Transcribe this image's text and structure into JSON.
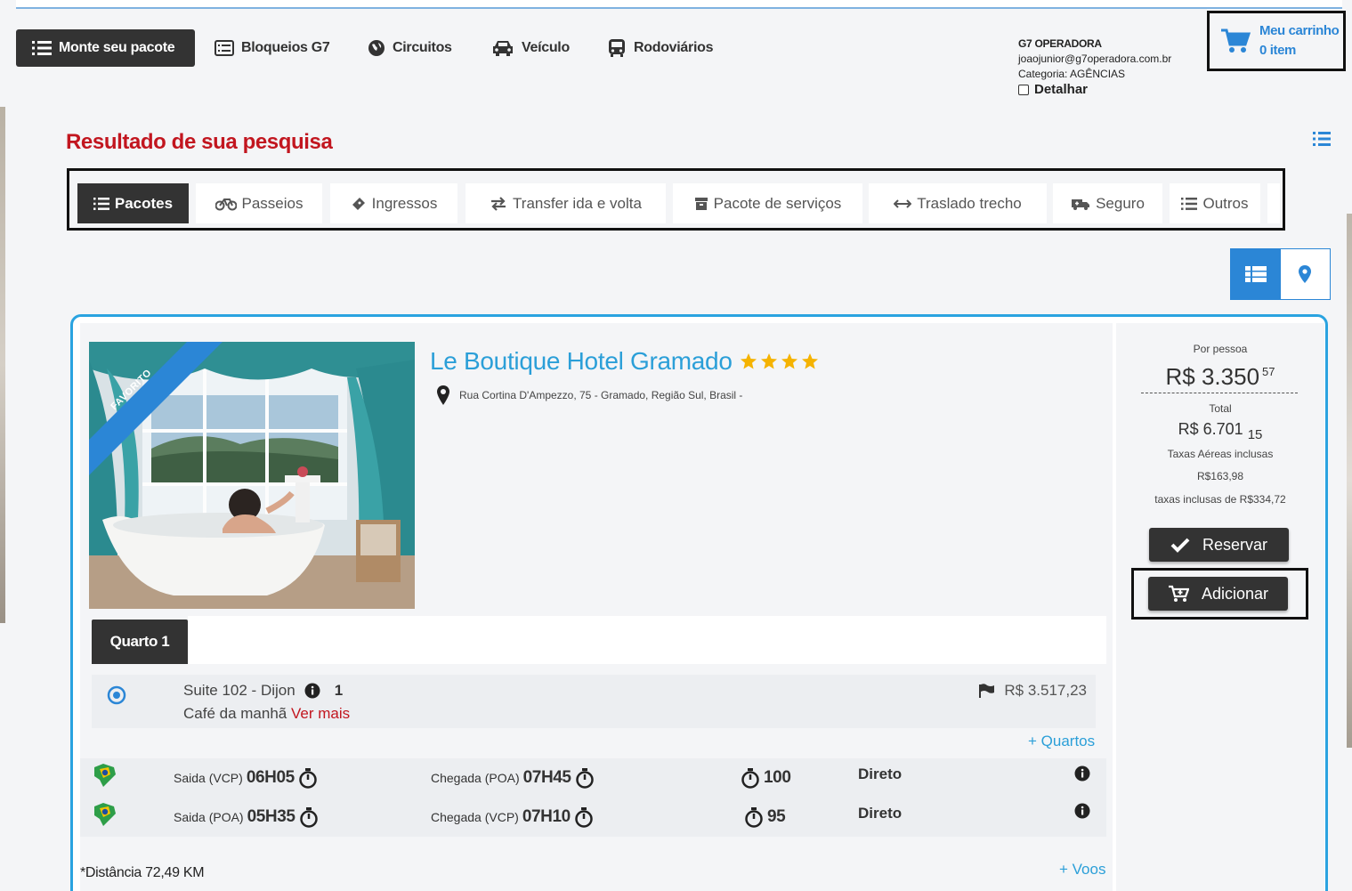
{
  "header": {
    "nav": [
      {
        "label": "Monte seu pacote",
        "icon": "list-icon"
      },
      {
        "label": "Bloqueios G7",
        "icon": "list-alt-icon"
      },
      {
        "label": "Circuitos",
        "icon": "globe-icon"
      },
      {
        "label": "Veículo",
        "icon": "car-icon"
      },
      {
        "label": "Rodoviários",
        "icon": "bus-icon"
      }
    ],
    "account": {
      "company": "G7 OPERADORA",
      "email": "joaojunior@g7operadora.com.br",
      "category": "Categoria: AGÊNCIAS",
      "detail_label": "Detalhar"
    },
    "cart": {
      "title": "Meu carrinho",
      "count": "0 item"
    }
  },
  "results": {
    "title": "Resultado de sua pesquisa",
    "tabs": [
      {
        "label": "Pacotes",
        "icon": "list-icon"
      },
      {
        "label": "Passeios",
        "icon": "bicycle-icon"
      },
      {
        "label": "Ingressos",
        "icon": "ticket-icon"
      },
      {
        "label": "Transfer ida e volta",
        "icon": "exchange-icon"
      },
      {
        "label": "Pacote de serviços",
        "icon": "archive-icon"
      },
      {
        "label": "Traslado trecho",
        "icon": "arrows-h-icon"
      },
      {
        "label": "Seguro",
        "icon": "ambulance-icon"
      },
      {
        "label": "Outros",
        "icon": "list-icon"
      }
    ]
  },
  "hotel": {
    "ribbon": "FAVORITO",
    "name": "Le Boutique Hotel Gramado",
    "stars": 4,
    "address": "Rua Cortina D'Ampezzo, 75 - Gramado, Região Sul, Brasil -",
    "price": {
      "per_person_label": "Por pessoa",
      "per_person_main": "R$ 3.350",
      "per_person_cents": "57",
      "total_label": "Total",
      "total_main": "R$ 6.701",
      "total_cents": "15",
      "air_tax_label": "Taxas Aéreas inclusas",
      "air_tax_value": "R$163,98",
      "included_tax": "taxas inclusas de R$334,72"
    },
    "buttons": {
      "reserve": "Reservar",
      "add": "Adicionar"
    },
    "room": {
      "tab": "Quarto 1",
      "name": "Suite 102 - Dijon",
      "qty": "1",
      "board": "Café da manhã",
      "more": "Ver mais",
      "price": "R$ 3.517,23"
    },
    "more_rooms": "+ Quartos",
    "flights": [
      {
        "dep_label": "Saida (VCP)",
        "dep_time": "06H05",
        "arr_label": "Chegada (POA)",
        "arr_time": "07H45",
        "duration": "100",
        "type": "Direto"
      },
      {
        "dep_label": "Saida (POA)",
        "dep_time": "05H35",
        "arr_label": "Chegada (VCP)",
        "arr_time": "07H10",
        "duration": "95",
        "type": "Direto"
      }
    ],
    "more_flights": "+ Voos",
    "distance": "*Distância 72,49 KM"
  }
}
